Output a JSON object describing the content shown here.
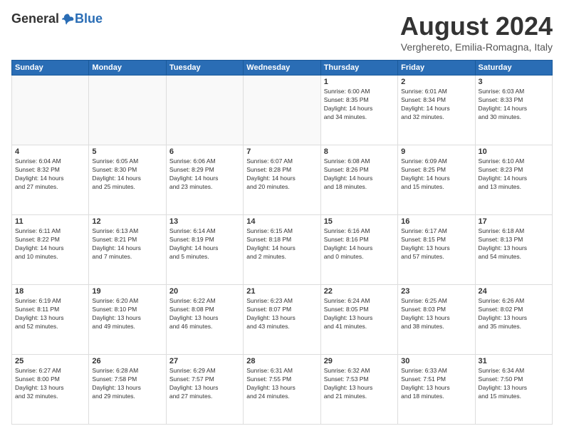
{
  "logo": {
    "general": "General",
    "blue": "Blue"
  },
  "title": "August 2024",
  "location": "Verghereto, Emilia-Romagna, Italy",
  "headers": [
    "Sunday",
    "Monday",
    "Tuesday",
    "Wednesday",
    "Thursday",
    "Friday",
    "Saturday"
  ],
  "weeks": [
    [
      {
        "day": "",
        "info": ""
      },
      {
        "day": "",
        "info": ""
      },
      {
        "day": "",
        "info": ""
      },
      {
        "day": "",
        "info": ""
      },
      {
        "day": "1",
        "info": "Sunrise: 6:00 AM\nSunset: 8:35 PM\nDaylight: 14 hours\nand 34 minutes."
      },
      {
        "day": "2",
        "info": "Sunrise: 6:01 AM\nSunset: 8:34 PM\nDaylight: 14 hours\nand 32 minutes."
      },
      {
        "day": "3",
        "info": "Sunrise: 6:03 AM\nSunset: 8:33 PM\nDaylight: 14 hours\nand 30 minutes."
      }
    ],
    [
      {
        "day": "4",
        "info": "Sunrise: 6:04 AM\nSunset: 8:32 PM\nDaylight: 14 hours\nand 27 minutes."
      },
      {
        "day": "5",
        "info": "Sunrise: 6:05 AM\nSunset: 8:30 PM\nDaylight: 14 hours\nand 25 minutes."
      },
      {
        "day": "6",
        "info": "Sunrise: 6:06 AM\nSunset: 8:29 PM\nDaylight: 14 hours\nand 23 minutes."
      },
      {
        "day": "7",
        "info": "Sunrise: 6:07 AM\nSunset: 8:28 PM\nDaylight: 14 hours\nand 20 minutes."
      },
      {
        "day": "8",
        "info": "Sunrise: 6:08 AM\nSunset: 8:26 PM\nDaylight: 14 hours\nand 18 minutes."
      },
      {
        "day": "9",
        "info": "Sunrise: 6:09 AM\nSunset: 8:25 PM\nDaylight: 14 hours\nand 15 minutes."
      },
      {
        "day": "10",
        "info": "Sunrise: 6:10 AM\nSunset: 8:23 PM\nDaylight: 14 hours\nand 13 minutes."
      }
    ],
    [
      {
        "day": "11",
        "info": "Sunrise: 6:11 AM\nSunset: 8:22 PM\nDaylight: 14 hours\nand 10 minutes."
      },
      {
        "day": "12",
        "info": "Sunrise: 6:13 AM\nSunset: 8:21 PM\nDaylight: 14 hours\nand 7 minutes."
      },
      {
        "day": "13",
        "info": "Sunrise: 6:14 AM\nSunset: 8:19 PM\nDaylight: 14 hours\nand 5 minutes."
      },
      {
        "day": "14",
        "info": "Sunrise: 6:15 AM\nSunset: 8:18 PM\nDaylight: 14 hours\nand 2 minutes."
      },
      {
        "day": "15",
        "info": "Sunrise: 6:16 AM\nSunset: 8:16 PM\nDaylight: 14 hours\nand 0 minutes."
      },
      {
        "day": "16",
        "info": "Sunrise: 6:17 AM\nSunset: 8:15 PM\nDaylight: 13 hours\nand 57 minutes."
      },
      {
        "day": "17",
        "info": "Sunrise: 6:18 AM\nSunset: 8:13 PM\nDaylight: 13 hours\nand 54 minutes."
      }
    ],
    [
      {
        "day": "18",
        "info": "Sunrise: 6:19 AM\nSunset: 8:11 PM\nDaylight: 13 hours\nand 52 minutes."
      },
      {
        "day": "19",
        "info": "Sunrise: 6:20 AM\nSunset: 8:10 PM\nDaylight: 13 hours\nand 49 minutes."
      },
      {
        "day": "20",
        "info": "Sunrise: 6:22 AM\nSunset: 8:08 PM\nDaylight: 13 hours\nand 46 minutes."
      },
      {
        "day": "21",
        "info": "Sunrise: 6:23 AM\nSunset: 8:07 PM\nDaylight: 13 hours\nand 43 minutes."
      },
      {
        "day": "22",
        "info": "Sunrise: 6:24 AM\nSunset: 8:05 PM\nDaylight: 13 hours\nand 41 minutes."
      },
      {
        "day": "23",
        "info": "Sunrise: 6:25 AM\nSunset: 8:03 PM\nDaylight: 13 hours\nand 38 minutes."
      },
      {
        "day": "24",
        "info": "Sunrise: 6:26 AM\nSunset: 8:02 PM\nDaylight: 13 hours\nand 35 minutes."
      }
    ],
    [
      {
        "day": "25",
        "info": "Sunrise: 6:27 AM\nSunset: 8:00 PM\nDaylight: 13 hours\nand 32 minutes."
      },
      {
        "day": "26",
        "info": "Sunrise: 6:28 AM\nSunset: 7:58 PM\nDaylight: 13 hours\nand 29 minutes."
      },
      {
        "day": "27",
        "info": "Sunrise: 6:29 AM\nSunset: 7:57 PM\nDaylight: 13 hours\nand 27 minutes."
      },
      {
        "day": "28",
        "info": "Sunrise: 6:31 AM\nSunset: 7:55 PM\nDaylight: 13 hours\nand 24 minutes."
      },
      {
        "day": "29",
        "info": "Sunrise: 6:32 AM\nSunset: 7:53 PM\nDaylight: 13 hours\nand 21 minutes."
      },
      {
        "day": "30",
        "info": "Sunrise: 6:33 AM\nSunset: 7:51 PM\nDaylight: 13 hours\nand 18 minutes."
      },
      {
        "day": "31",
        "info": "Sunrise: 6:34 AM\nSunset: 7:50 PM\nDaylight: 13 hours\nand 15 minutes."
      }
    ]
  ]
}
